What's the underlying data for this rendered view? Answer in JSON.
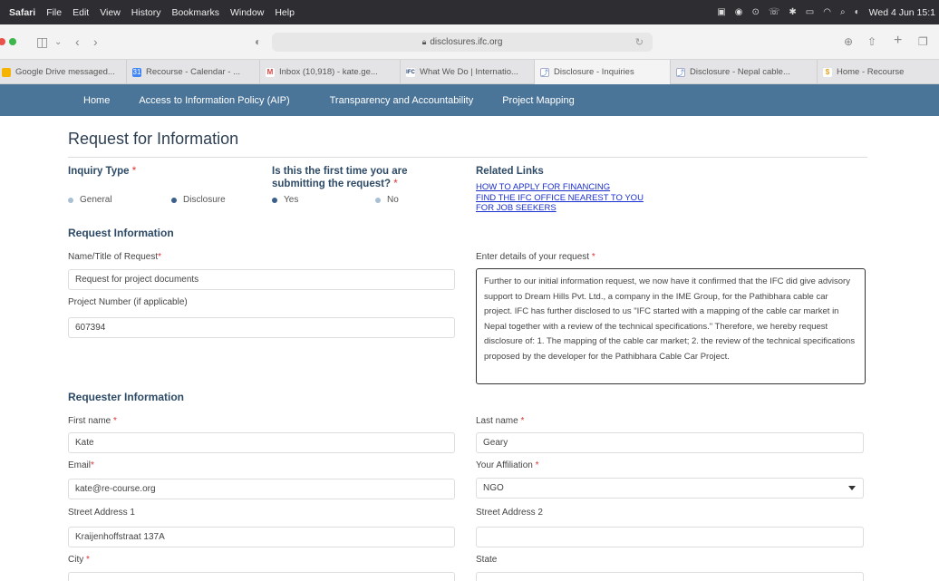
{
  "menubar": {
    "app": "Safari",
    "items": [
      "File",
      "Edit",
      "View",
      "History",
      "Bookmarks",
      "Window",
      "Help"
    ],
    "datetime": "Wed 4 Jun 15:1"
  },
  "browser": {
    "url": "disclosures.ifc.org",
    "tabs": [
      {
        "title": "Google Drive messaged..."
      },
      {
        "title": "Recourse - Calendar - ..."
      },
      {
        "title": "Inbox (10,918) - kate.ge..."
      },
      {
        "title": "What We Do | Internatio..."
      },
      {
        "title": "Disclosure - Inquiries"
      },
      {
        "title": "Disclosure - Nepal cable..."
      },
      {
        "title": "Home - Recourse"
      }
    ]
  },
  "sitenav": {
    "links": [
      "Home",
      "Access to Information Policy (AIP)",
      "Transparency and Accountability",
      "Project Mapping"
    ]
  },
  "form": {
    "title": "Request for Information",
    "inquiry_type": {
      "label": "Inquiry Type",
      "options": [
        "General",
        "Disclosure"
      ]
    },
    "first_time": {
      "label_line1": "Is this the first time you are",
      "label_line2": "submitting the request?",
      "options": [
        "Yes",
        "No"
      ]
    },
    "related": {
      "title": "Related Links",
      "links": [
        "HOW TO APPLY FOR FINANCING",
        "FIND THE IFC OFFICE NEAREST TO YOU",
        "FOR JOB SEEKERS"
      ]
    },
    "request_info": {
      "heading": "Request Information",
      "name_label": "Name/Title of Request",
      "name_value": "Request for project documents",
      "project_label": "Project Number (if applicable)",
      "project_value": "607394",
      "details_label": "Enter details of your request",
      "details_value": "Further to our initial information request, we now have it confirmed that the IFC did give advisory support to Dream Hills Pvt. Ltd., a company in the IME Group, for the Pathibhara cable car project. IFC has further disclosed to us \"IFC started with a mapping of the cable car market in Nepal together with a review of the technical specifications.\" Therefore, we hereby request disclosure of: 1. The mapping of the cable car market; 2. the review of the technical specifications proposed by the developer for the Pathibhara Cable Car Project."
    },
    "requester": {
      "heading": "Requester Information",
      "first_name_label": "First name",
      "first_name_value": "Kate",
      "last_name_label": "Last name",
      "last_name_value": "Geary",
      "email_label": "Email",
      "email_value": "kate@re-course.org",
      "affiliation_label": "Your Affiliation",
      "affiliation_value": "NGO",
      "street1_label": "Street Address 1",
      "street1_value": "Kraijenhoffstraat 137A",
      "street2_label": "Street Address 2",
      "street2_value": "",
      "city_label": "City",
      "state_label": "State"
    },
    "required_mark": "*"
  }
}
